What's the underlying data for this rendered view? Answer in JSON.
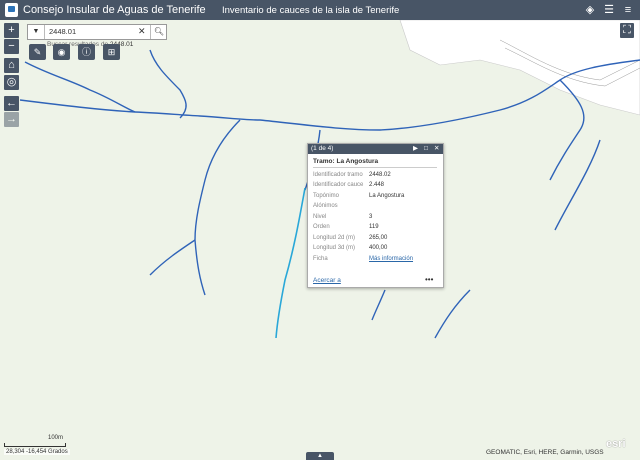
{
  "header": {
    "title": "Consejo Insular de Aguas de Tenerife",
    "subtitle": "Inventario de cauces de la isla de Tenerife",
    "icons": [
      "layers-icon",
      "legend-icon",
      "menu-icon"
    ]
  },
  "map_controls": {
    "zoom_in": "+",
    "zoom_out": "−",
    "home_icon": "home-icon",
    "locate_icon": "locate-icon",
    "back_icon": "arrow-left-icon",
    "forward_icon": "arrow-right-icon",
    "fullscreen_icon": "fullscreen-icon"
  },
  "search": {
    "value": "2448.01",
    "hint_prefix": "Buscar resultados de",
    "hint_term": "2448.01"
  },
  "tools": [
    "draw-icon",
    "measure-icon",
    "info-icon",
    "select-icon"
  ],
  "popup": {
    "count": "(1 de 4)",
    "title": "Tramo: La Angostura",
    "fields": [
      {
        "key": "Identificador tramo",
        "value": "2448.02"
      },
      {
        "key": "Identificador cauce",
        "value": "2.448"
      },
      {
        "key": "Topónimo",
        "value": "La Angostura"
      },
      {
        "key": "Alónimos",
        "value": ""
      },
      {
        "key": "Nivel",
        "value": "3"
      },
      {
        "key": "Orden",
        "value": "119"
      },
      {
        "key": "Longitud 2d (m)",
        "value": "265,00"
      },
      {
        "key": "Longitud 3d (m)",
        "value": "400,00"
      },
      {
        "key": "Ficha",
        "value": "Más información"
      }
    ],
    "zoom_link": "Acercar a",
    "more": "•••"
  },
  "scale": {
    "label": "100m"
  },
  "coords": "28,304 -16,454 Grados",
  "attribution": "GEOMATIC, Esri, HERE, Garmin, USGS",
  "esri_logo": "esri",
  "colors": {
    "header": "#485566",
    "map_bg": "#eef3e8",
    "stream": "#2f63b8",
    "selected_stream": "#29a7d8",
    "link": "#2a67a8"
  }
}
